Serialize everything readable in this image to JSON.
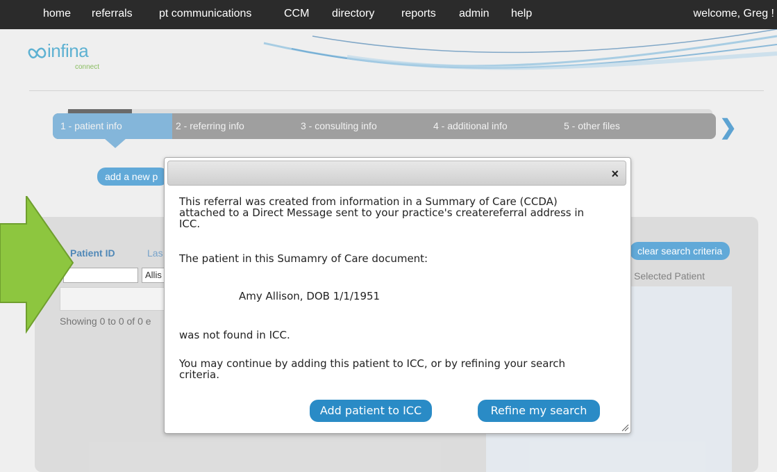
{
  "nav": {
    "items": [
      "home",
      "referrals",
      "pt communications",
      "CCM",
      "directory",
      "reports",
      "admin",
      "help"
    ],
    "welcome": "welcome, Greg !"
  },
  "logo": {
    "name": "infina",
    "sub": "connect"
  },
  "steps": [
    "1 - patient info",
    "2 - referring info",
    "3 - consulting info",
    "4 - additional info",
    "5 - other files"
  ],
  "background": {
    "add_new_button": "add a new p",
    "patient_id_label": "Patient ID",
    "last_label": "Las",
    "last_name_value": "Allis",
    "clear_search_button": "clear search criteria",
    "selected_patient_label": "Selected Patient",
    "showing_text": "Showing 0 to 0 of 0 e"
  },
  "modal": {
    "message_1": "This referral was created from information in a Summary of Care (CCDA) attached to a Direct Message sent to your practice's createreferral address in ICC.",
    "message_2": "The patient in this Sumamry of Care document:",
    "patient_line": "Amy Allison, DOB 1/1/1951",
    "message_3": "was not found in ICC.",
    "message_4": "You may continue by adding this patient to ICC, or by refining your search criteria.",
    "add_button": "Add patient to ICC",
    "refine_button": "Refine my search",
    "close_symbol": "×"
  },
  "colors": {
    "nav_bg": "#2b2b2b",
    "accent_blue": "#2a8bc6",
    "active_step": "#6aa7d2",
    "callout_green": "#8dc63f"
  }
}
